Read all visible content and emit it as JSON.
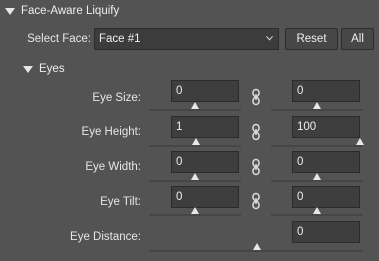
{
  "panel": {
    "title": "Face-Aware Liquify"
  },
  "face": {
    "label": "Select Face:",
    "value": "Face #1",
    "reset_label": "Reset",
    "all_label": "All"
  },
  "eyes": {
    "title": "Eyes",
    "rows": [
      {
        "label": "Eye Size:",
        "left": "0",
        "right": "0"
      },
      {
        "label": "Eye Height:",
        "left": "1",
        "right": "100"
      },
      {
        "label": "Eye Width:",
        "left": "0",
        "right": "0"
      },
      {
        "label": "Eye Tilt:",
        "left": "0",
        "right": "0"
      }
    ],
    "distance": {
      "label": "Eye Distance:",
      "value": "0"
    }
  },
  "colors": {
    "panel_bg": "#535353",
    "field_bg": "#3e3e3e"
  },
  "icons": [
    "triangle-down-icon",
    "chevron-down-icon",
    "link-icon",
    "slider-thumb-icon"
  ]
}
